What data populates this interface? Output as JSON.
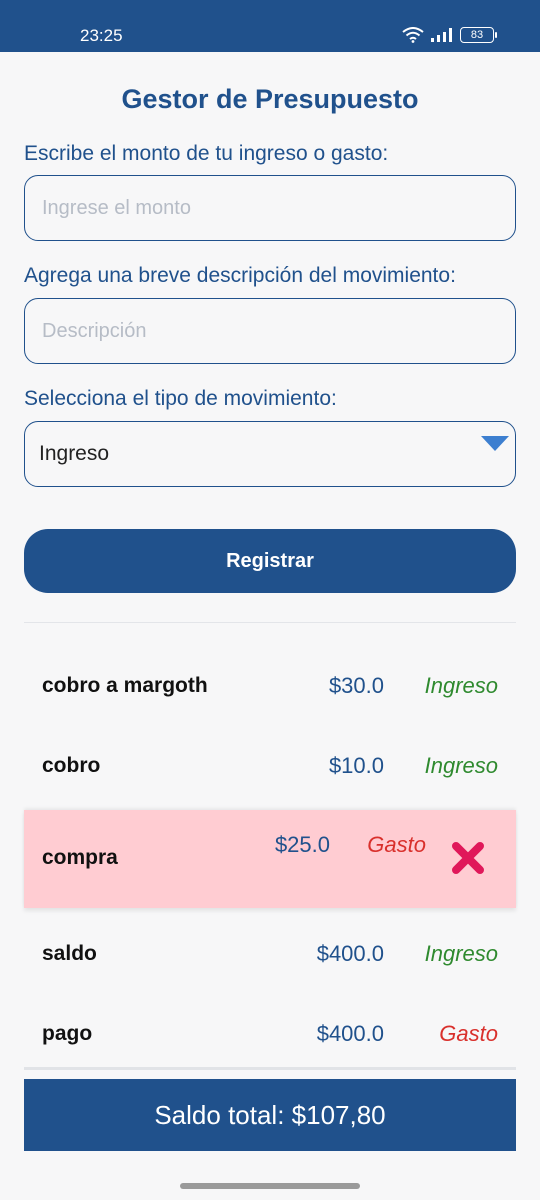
{
  "status_bar": {
    "time": "23:25",
    "battery": "83"
  },
  "app": {
    "title": "Gestor de Presupuesto"
  },
  "form": {
    "amount_label": "Escribe el monto de tu ingreso o gasto:",
    "amount_placeholder": "Ingrese el monto",
    "amount_value": "",
    "description_label": "Agrega una breve descripción del movimiento:",
    "description_placeholder": "Descripción",
    "description_value": "",
    "type_label": "Selecciona el tipo de movimiento:",
    "type_selected": "Ingreso",
    "register_button": "Registrar"
  },
  "movements": [
    {
      "description": "cobro a margoth",
      "amount": "$30.0",
      "type": "Ingreso"
    },
    {
      "description": "cobro",
      "amount": "$10.0",
      "type": "Ingreso"
    },
    {
      "description": "compra",
      "amount": "$25.0",
      "type": "Gasto",
      "selected": true
    },
    {
      "description": "saldo",
      "amount": "$400.0",
      "type": "Ingreso"
    },
    {
      "description": "pago",
      "amount": "$400.0",
      "type": "Gasto"
    }
  ],
  "total": {
    "text": "Saldo total: $107,80"
  },
  "colors": {
    "primary": "#20518c",
    "income": "#2f8a2f",
    "expense": "#d9302c",
    "selected_row": "#ffccd2",
    "delete": "#e0185a"
  }
}
